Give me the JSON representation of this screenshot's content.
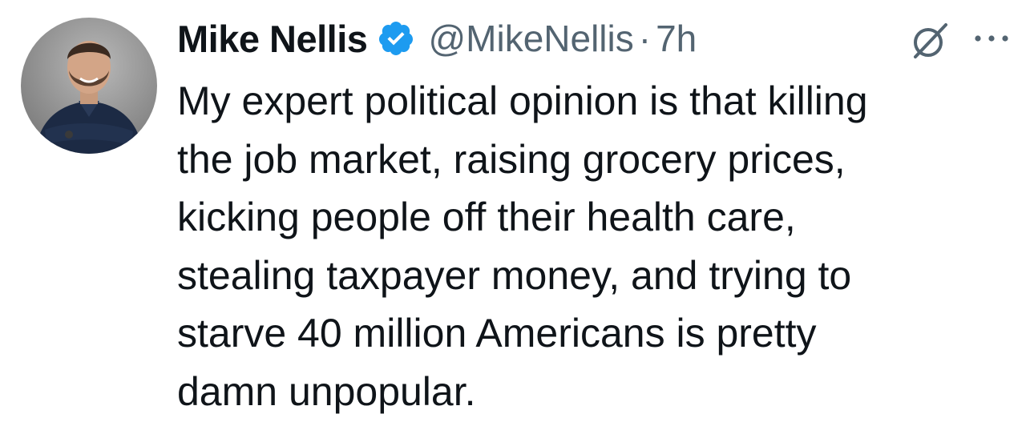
{
  "tweet": {
    "author": {
      "name": "Mike Nellis",
      "handle": "@MikeNellis",
      "verified_icon": "verified-badge-icon"
    },
    "separator": "·",
    "time": "7h",
    "text_lines": [
      "My expert political opinion is that killing",
      "the job market, raising grocery prices,",
      "kicking people off their health care,",
      "stealing taxpayer money, and trying to",
      "starve 40 million Americans is pretty",
      "damn unpopular."
    ],
    "icons": {
      "grok": "grok-icon",
      "more": "more-options-icon"
    }
  },
  "colors": {
    "text": "#0f1419",
    "secondary": "#536471",
    "verified": "#1d9bf0",
    "background": "#ffffff"
  }
}
